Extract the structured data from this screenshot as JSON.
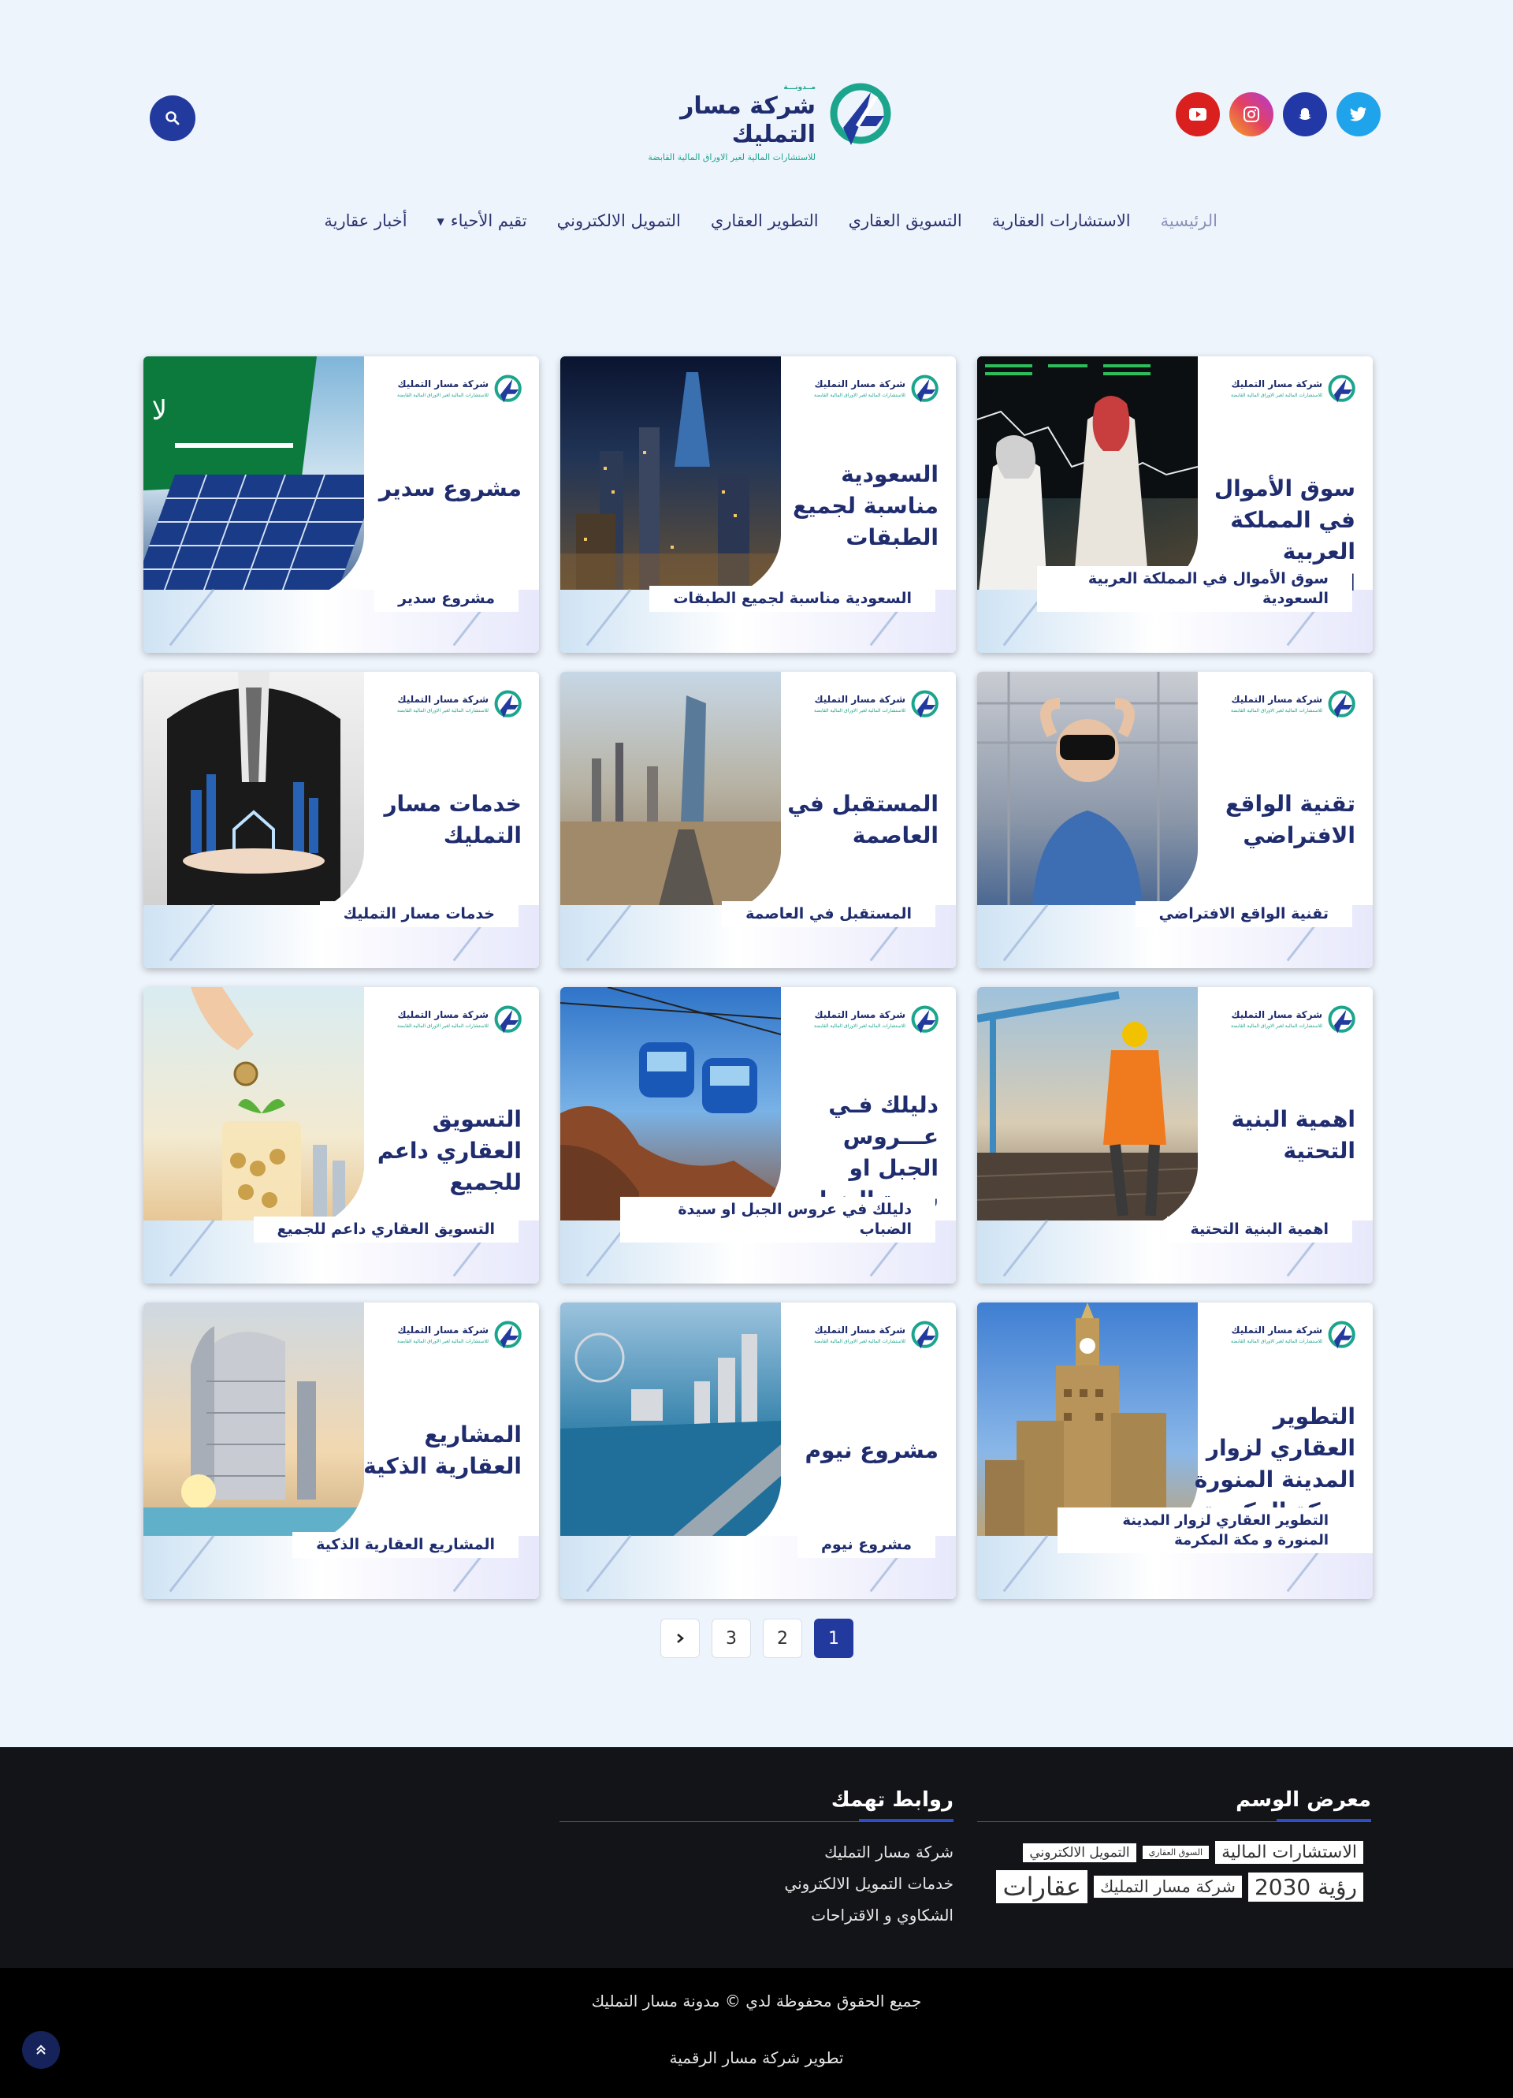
{
  "header": {
    "logo": {
      "kicker": "مــدونـــة",
      "name": "شركة مسار التمليك",
      "tagline": "للاستشارات المالية لغير الاوراق المالية القابضة"
    },
    "social": [
      "youtube-icon",
      "instagram-icon",
      "snapchat-icon",
      "twitter-icon"
    ],
    "search_icon": "search-icon"
  },
  "nav": {
    "items": [
      {
        "label": "الرئيسية",
        "active": true
      },
      {
        "label": "الاستشارات العقارية"
      },
      {
        "label": "التسويق العقاري"
      },
      {
        "label": "التطوير العقاري"
      },
      {
        "label": "التمويل الالكتروني"
      },
      {
        "label": "تقيم الأحياء",
        "dropdown": true
      },
      {
        "label": "أخبار عقارية"
      }
    ]
  },
  "brand_colors": {
    "navy": "#1f2c6e",
    "teal": "#1aa58c",
    "accent": "#223a9e"
  },
  "cards": [
    {
      "headline": "سوق الأموال في المملكة العربية السعودية",
      "caption": "سوق الأموال في المملكة العربية  السعودية",
      "logo_name": "شركة مسار التمليك",
      "logo_tagline": "للاستشارات المالية لغير الاوراق المالية القابضة"
    },
    {
      "headline": "السعودية مناسبة لجميع الطبقات",
      "caption": "السعودية مناسبة لجميع الطبقات",
      "logo_name": "شركة مسار التمليك",
      "logo_tagline": "للاستشارات المالية لغير الاوراق المالية القابضة"
    },
    {
      "headline": "مشروع سدير",
      "caption": "مشروع سدير",
      "logo_name": "شركة مسار التمليك",
      "logo_tagline": "للاستشارات المالية لغير الاوراق المالية القابضة"
    },
    {
      "headline": "تقنية الواقع الافتراضي",
      "caption": "تقنية الواقع الافتراضي",
      "logo_name": "شركة مسار التمليك",
      "logo_tagline": "للاستشارات المالية لغير الاوراق المالية القابضة"
    },
    {
      "headline": "المستقبل في العاصمة",
      "caption": "المستقبل في العاصمة",
      "logo_name": "شركة مسار التمليك",
      "logo_tagline": "للاستشارات المالية لغير الاوراق المالية القابضة"
    },
    {
      "headline": "خدمات مسار التمليك",
      "caption": "خدمات مسار التمليك",
      "logo_name": "شركة مسار التمليك",
      "logo_tagline": "للاستشارات المالية لغير الاوراق المالية القابضة"
    },
    {
      "headline": "اهمية البنية التحتية",
      "caption": "اهمية البنية التحتية",
      "logo_name": "شركة مسار التمليك",
      "logo_tagline": "للاستشارات المالية لغير الاوراق المالية القابضة"
    },
    {
      "headline": "دليلك فـي عـــروس الجبل او سيدة الضباب",
      "caption": "دليلك في عروس الجبل او سيدة الضباب",
      "logo_name": "شركة مسار التمليك",
      "logo_tagline": "للاستشارات المالية لغير الاوراق المالية القابضة"
    },
    {
      "headline": "التسويق العقاري داعم للجميع",
      "caption": "التسويق العقاري داعم للجميع",
      "logo_name": "شركة مسار التمليك",
      "logo_tagline": "للاستشارات المالية لغير الاوراق المالية القابضة"
    },
    {
      "headline": "التطوير العقاري لزوار المدينة المنورة و مكة المكرمة",
      "caption": "التطوير العقاري لزوار المدينة المنورة و مكة المكرمة",
      "logo_name": "شركة مسار التمليك",
      "logo_tagline": "للاستشارات المالية لغير الاوراق المالية القابضة"
    },
    {
      "headline": "مشروع نيوم",
      "caption": "مشروع نيوم",
      "logo_name": "شركة مسار التمليك",
      "logo_tagline": "للاستشارات المالية لغير الاوراق المالية القابضة"
    },
    {
      "headline": "المشاريع العقارية الذكية",
      "caption": "المشاريع العقارية الذكية",
      "logo_name": "شركة مسار التمليك",
      "logo_tagline": "للاستشارات المالية لغير الاوراق المالية القابضة"
    }
  ],
  "pagination": {
    "pages": [
      "1",
      "2",
      "3"
    ],
    "current": "1",
    "next_icon": "chevron-right-icon"
  },
  "footer": {
    "tags_title": "معرض الوسم",
    "tags": [
      {
        "label": "الاستشارات المالية"
      },
      {
        "label": "السوق العقاري"
      },
      {
        "label": "التمويل الالكتروني"
      },
      {
        "label": "رؤية 2030"
      },
      {
        "label": "شركة مسار التمليك"
      },
      {
        "label": "عقارات"
      }
    ],
    "links_title": "روابط تهمك",
    "links": [
      "شركة مسار التمليك",
      "خدمات التمويل الالكتروني",
      "الشكاوي و الاقتراحات"
    ],
    "copyright": "جميع الحقوق محفوظة لدي © مدونة مسار التمليك",
    "developer": "تطوير شركة مسار الرقمية",
    "back_to_top_icon": "double-chevron-up-icon"
  }
}
